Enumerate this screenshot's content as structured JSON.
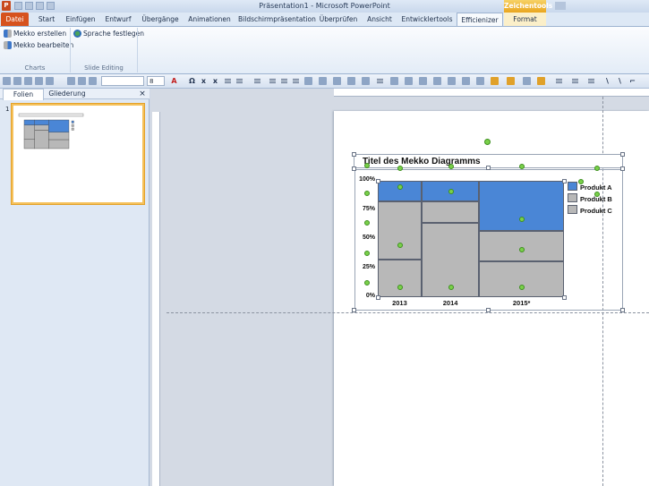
{
  "window": {
    "title": "Präsentation1 - Microsoft PowerPoint",
    "app_icon": "P",
    "context_tab_group": "Zeichentools"
  },
  "tabs": [
    {
      "label": "Datei"
    },
    {
      "label": "Start"
    },
    {
      "label": "Einfügen"
    },
    {
      "label": "Entwurf"
    },
    {
      "label": "Übergänge"
    },
    {
      "label": "Animationen"
    },
    {
      "label": "Bildschirmpräsentation"
    },
    {
      "label": "Überprüfen"
    },
    {
      "label": "Ansicht"
    },
    {
      "label": "Entwicklertools"
    },
    {
      "label": "Efficienizer"
    },
    {
      "label": "Format"
    }
  ],
  "ribbon": {
    "charts": {
      "create": "Mekko erstellen",
      "edit": "Mekko bearbeiten",
      "label": "Charts"
    },
    "slide_editing": {
      "language": "Sprache festlegen",
      "label": "Slide Editing"
    }
  },
  "toolbar": {
    "font_size": "8"
  },
  "panel": {
    "tab_slides": "Folien",
    "tab_outline": "Gliederung",
    "close": "×",
    "slide_number": "1"
  },
  "chart_data": {
    "type": "bar",
    "title": "Titel des Mekko Diagramms",
    "categories": [
      "2013",
      "2014",
      "2015*"
    ],
    "ytick_labels": [
      "100%",
      "75%",
      "50%",
      "25%",
      "0%"
    ],
    "widths": [
      0.235,
      0.31,
      0.455
    ],
    "series": [
      {
        "name": "Produkt A",
        "values": [
          0.18,
          0.18,
          0.43
        ]
      },
      {
        "name": "Produkt B",
        "values": [
          0.5,
          0.18,
          0.26
        ]
      },
      {
        "name": "Produkt C",
        "values": [
          0.32,
          0.64,
          0.31
        ]
      }
    ],
    "colors": {
      "Produkt A": "#4a86d6",
      "Produkt B": "#b8b8b8",
      "Produkt C": "#b8b8b8"
    },
    "legend": "right"
  }
}
